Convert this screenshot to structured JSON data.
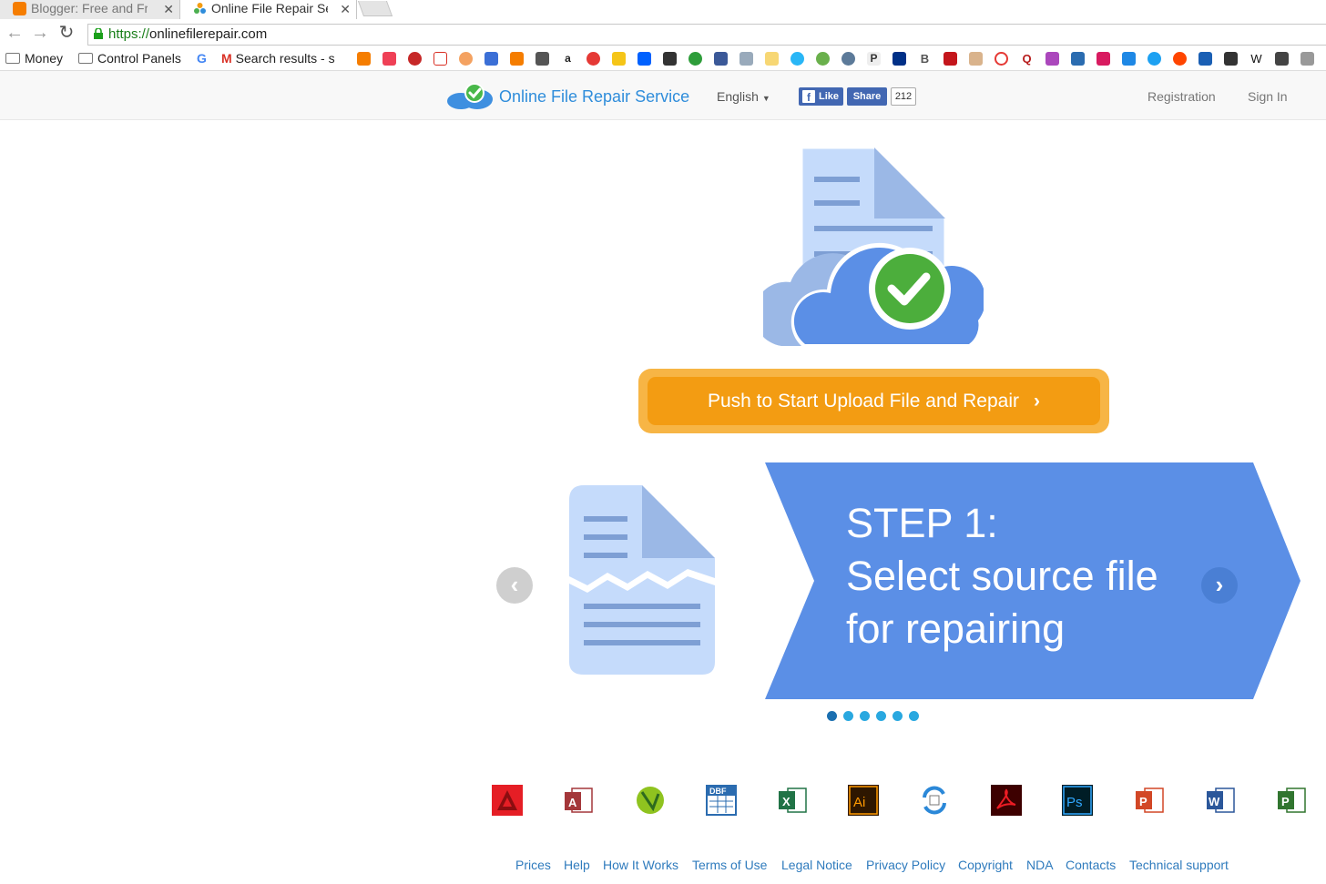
{
  "browser": {
    "tabs": [
      {
        "title": "Blogger: Free and Fr",
        "active": false
      },
      {
        "title": "Online File Repair Se",
        "active": true
      }
    ],
    "url_scheme": "https://",
    "url_host": "onlinefilerepair.com",
    "bookmarks": [
      {
        "label": "Money",
        "icon": "folder-icon"
      },
      {
        "label": "Control Panels",
        "icon": "folder-icon"
      },
      {
        "label": "Search results - s",
        "icon": "gmail-icon"
      }
    ]
  },
  "header": {
    "brand": "Online File Repair Service",
    "language": "English",
    "fb_like": "Like",
    "fb_share": "Share",
    "fb_count": "212",
    "registration": "Registration",
    "sign_in": "Sign In"
  },
  "hero": {
    "cta_label": "Push to Start Upload File and Repair"
  },
  "slider": {
    "step_title": "STEP 1:",
    "step_line1": "Select source file",
    "step_line2": "for repairing",
    "dots_total": 6,
    "active_dot": 1
  },
  "formats": [
    "autocad-icon",
    "access-icon",
    "coreldraw-icon",
    "dbf-icon",
    "excel-icon",
    "illustrator-icon",
    "outlook-sync-icon",
    "acrobat-icon",
    "photoshop-icon",
    "powerpoint-icon",
    "word-icon",
    "project-icon"
  ],
  "footer": {
    "links": [
      "Prices",
      "Help",
      "How It Works",
      "Terms of Use",
      "Legal Notice",
      "Privacy Policy",
      "Copyright",
      "NDA",
      "Contacts",
      "Technical support"
    ]
  },
  "colors": {
    "brand_blue": "#2f8ddb",
    "cta_orange": "#f39c12",
    "banner_blue": "#5b8fe6",
    "link_blue": "#2f7bbd"
  }
}
